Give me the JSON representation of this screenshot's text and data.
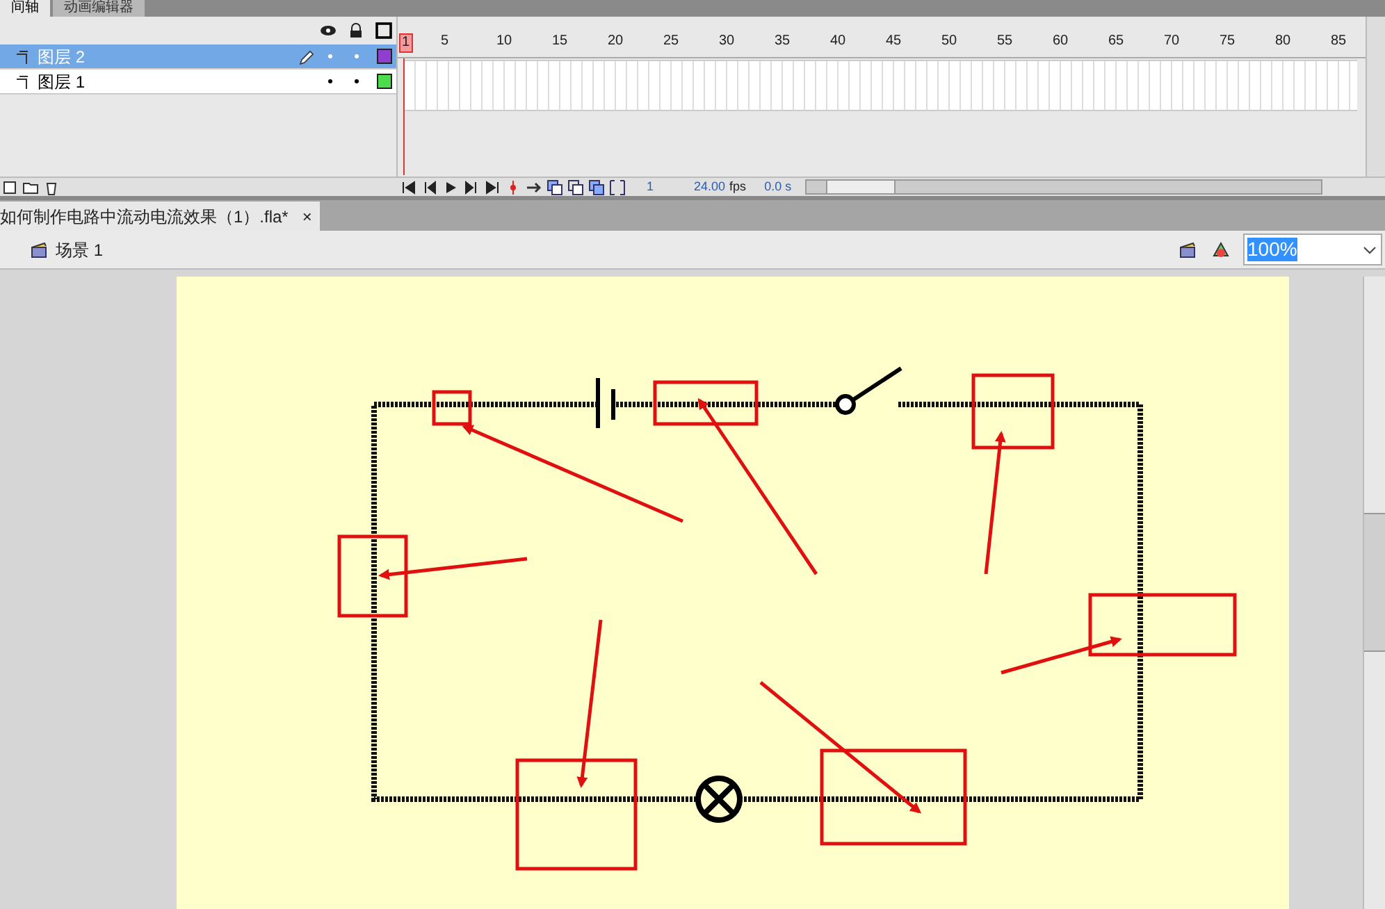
{
  "panel_tabs": [
    {
      "label": "间轴",
      "selected": true
    },
    {
      "label": "动画编辑器",
      "selected": false
    }
  ],
  "timeline": {
    "frame_numbers": [
      "1",
      "5",
      "10",
      "15",
      "20",
      "25",
      "30",
      "35",
      "40",
      "45",
      "50",
      "55",
      "60",
      "65",
      "70",
      "75",
      "80",
      "85"
    ],
    "layers": [
      {
        "name": "图层 2",
        "selected": true,
        "color": "#8e3fd0"
      },
      {
        "name": "图层 1",
        "selected": false,
        "color": "#4cdc4c"
      }
    ],
    "current_frame": "1",
    "fps": "24.00",
    "fps_unit": "fps",
    "time": "0.0 s"
  },
  "document_tab": {
    "title": "如何制作电路中流动电流效果（1）.fla*",
    "close": "×"
  },
  "scene": {
    "label": "场景 1"
  },
  "zoom": {
    "value": "100%"
  }
}
